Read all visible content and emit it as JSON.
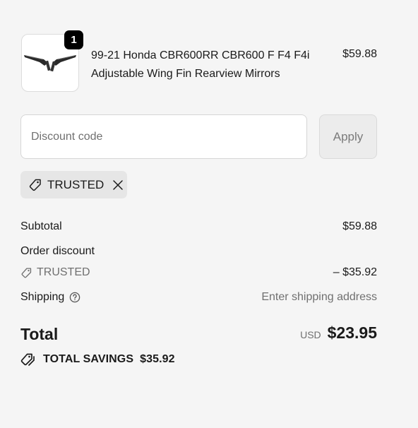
{
  "line_item": {
    "quantity": "1",
    "title": "99-21 Honda CBR600RR CBR600 F F4 F4i Adjustable Wing Fin Rearview Mirrors",
    "price": "$59.88",
    "thumbnail_icon": "mirror-product-image"
  },
  "discount": {
    "placeholder": "Discount code",
    "apply_label": "Apply",
    "applied_code": "TRUSTED"
  },
  "summary": {
    "subtotal_label": "Subtotal",
    "subtotal_value": "$59.88",
    "order_discount_label": "Order discount",
    "discount_code": "TRUSTED",
    "discount_value": "– $35.92",
    "shipping_label": "Shipping",
    "shipping_value": "Enter shipping address",
    "total_label": "Total",
    "currency": "USD",
    "total_value": "$23.95",
    "savings_label": "TOTAL SAVINGS",
    "savings_value": "$35.92"
  },
  "colors": {
    "background": "#f5f5f5",
    "text": "#1a1a1a",
    "muted": "#707070",
    "badge": "#000000"
  }
}
